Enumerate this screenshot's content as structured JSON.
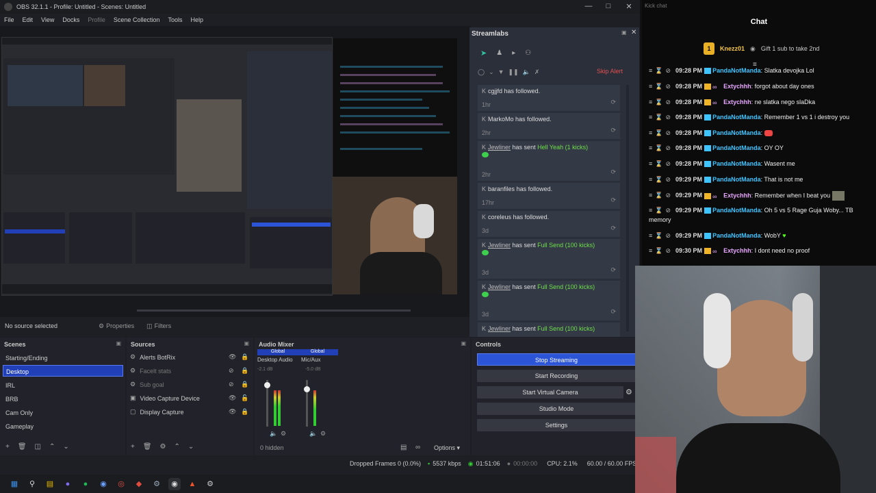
{
  "obs": {
    "title": "OBS 32.1.1 - Profile: Untitled - Scenes: Untitled",
    "menu": [
      "File",
      "Edit",
      "View",
      "Docks",
      "Profile",
      "Scene Collection",
      "Tools",
      "Help"
    ],
    "source_bar": {
      "no_source": "No source selected",
      "properties": "Properties",
      "filters": "Filters"
    },
    "scenes": {
      "title": "Scenes",
      "items": [
        "Starting/Ending",
        "Desktop",
        "IRL",
        "BRB",
        "Cam Only",
        "Gameplay"
      ],
      "selected": "Desktop"
    },
    "sources": {
      "title": "Sources",
      "items": [
        "Alerts BotRix",
        "Facelt stats",
        "Sub goal",
        "Video Capture Device",
        "Display Capture"
      ]
    },
    "mixer": {
      "title": "Audio Mixer",
      "channels": [
        {
          "scope": "Global",
          "name": "Desktop Audio",
          "db": "-2.1 dB"
        },
        {
          "scope": "Global",
          "name": "Mic/Aux",
          "db": "-5.0 dB"
        }
      ],
      "hidden": "0 hidden",
      "options": "Options"
    },
    "controls": {
      "title": "Controls",
      "buttons": [
        "Stop Streaming",
        "Start Recording",
        "Start Virtual Camera",
        "Studio Mode",
        "Settings"
      ]
    },
    "status": {
      "dropped": "Dropped Frames 0 (0.0%)",
      "bitrate": "5537 kbps",
      "live": "01:51:06",
      "rec": "00:00:00",
      "cpu": "CPU: 2.1%",
      "fps": "60.00 / 60.00 FPS"
    }
  },
  "streamlabs": {
    "title": "Streamlabs",
    "skip_alert": "Skip Alert",
    "events": [
      {
        "user": "cgjjfd",
        "action": "has followed.",
        "extra": "",
        "time": "1hr"
      },
      {
        "user": "MarkoMo",
        "action": "has followed.",
        "extra": "",
        "time": "2hr"
      },
      {
        "user": "Jewliner",
        "action": "has sent",
        "extra": "Hell Yeah (1 kicks)",
        "time": "2hr"
      },
      {
        "user": "baranfiles",
        "action": "has followed.",
        "extra": "",
        "time": "17hr"
      },
      {
        "user": "coreleus",
        "action": "has followed.",
        "extra": "",
        "time": "3d"
      },
      {
        "user": "Jewliner",
        "action": "has sent",
        "extra": "Full Send (100 kicks)",
        "time": "3d"
      },
      {
        "user": "Jewliner",
        "action": "has sent",
        "extra": "Full Send (100 kicks)",
        "time": "3d"
      },
      {
        "user": "Jewliner",
        "action": "has sent",
        "extra": "Full Send (100 kicks)",
        "time": ""
      }
    ]
  },
  "kick": {
    "window_title": "Kick chat",
    "header": "Chat",
    "pinned": {
      "badge": "1",
      "name": "Knezz01",
      "gift": "Gift 1 sub to take 2nd"
    },
    "messages": [
      {
        "time": "09:28 PM",
        "user": "PandaNotManda",
        "text": ": Slatka devojka Lol",
        "cls": "pn"
      },
      {
        "time": "09:28 PM",
        "user": "Extychhh",
        "text": ": forgot about day ones",
        "cls": "ex"
      },
      {
        "time": "09:28 PM",
        "user": "Extychhh",
        "text": ": ne slatka nego slaDka",
        "cls": "ex"
      },
      {
        "time": "09:28 PM",
        "user": "PandaNotManda",
        "text": ": Remember 1 vs 1 i destroy you",
        "cls": "pn"
      },
      {
        "time": "09:28 PM",
        "user": "PandaNotManda",
        "text": ":",
        "cls": "pn"
      },
      {
        "time": "09:28 PM",
        "user": "PandaNotManda",
        "text": ": OY OY",
        "cls": "pn"
      },
      {
        "time": "09:28 PM",
        "user": "PandaNotManda",
        "text": ": Wasent me",
        "cls": "pn"
      },
      {
        "time": "09:29 PM",
        "user": "PandaNotManda",
        "text": ": That is not me",
        "cls": "pn"
      },
      {
        "time": "09:29 PM",
        "user": "Extychhh",
        "text": ": Remember when I beat you",
        "cls": "ex"
      },
      {
        "time": "09:29 PM",
        "user": "PandaNotManda",
        "text": ": Oh 5 vs 5 Rage Guja Woby... TB",
        "cls": "pn"
      },
      {
        "time": "09:29 PM",
        "user": "PandaNotManda",
        "text": ": WobY",
        "cls": "pn"
      },
      {
        "time": "09:30 PM",
        "user": "Extychhh",
        "text": ": I dont need no proof",
        "cls": "ex"
      }
    ],
    "wrap_text": "memory"
  },
  "colors": {
    "accent": "#2b55d6",
    "kick_green": "#53fc18",
    "panda": "#3ec5ff",
    "exty": "#e9a8ff",
    "send_green": "#6ee04a",
    "skip_red": "#e05050"
  }
}
